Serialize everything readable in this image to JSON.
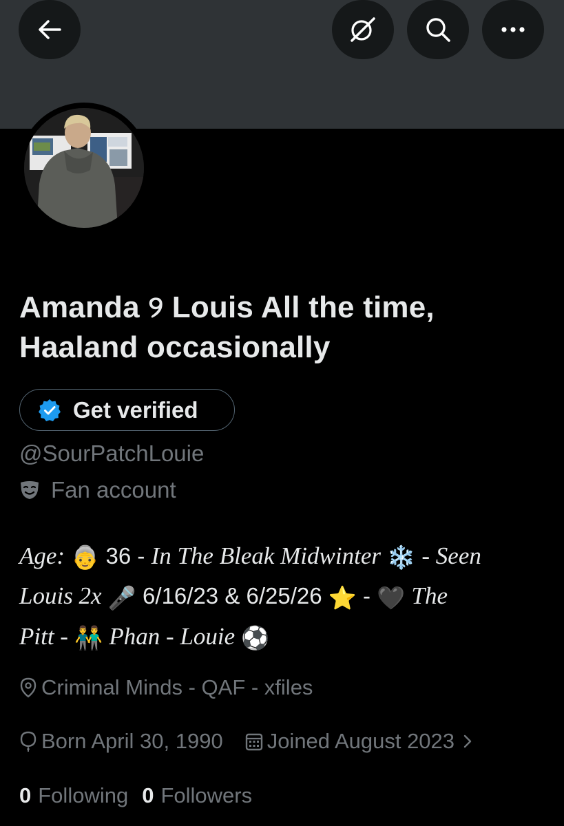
{
  "header": {
    "back_icon": "arrow-left-icon",
    "grok_icon": "grok-icon",
    "search_icon": "search-icon",
    "more_icon": "more-horizontal-icon"
  },
  "profile": {
    "avatar_alt": "profile photo",
    "display_name": "Amanda ୨ Louis All the time, Haaland occasionally",
    "verify_button_label": "Get verified",
    "handle": "@SourPatchLouie",
    "category_icon": "theater-mask-icon",
    "category": "Fan account",
    "bio": {
      "age_label": "Age:",
      "age_emoji": "👵",
      "age_value": "36 -",
      "midwinter": "In The Bleak Midwinter",
      "snow_emoji": "❄️",
      "seen": "- Seen",
      "louis": "Louis 2x",
      "mic_emoji": "🎤",
      "dates": "6/16/23 & 6/25/26",
      "star_emoji": "⭐",
      "dash1": "-",
      "heart_emoji": "🖤",
      "the": "The",
      "pitt": "Pitt -",
      "men_emoji": "👬",
      "phan": "Phan - Louie",
      "ball_emoji": "⚽"
    },
    "location": "Criminal Minds - QAF - xfiles",
    "birthday": "Born April 30, 1990",
    "joined": "Joined August 2023",
    "following_count": "0",
    "following_label": "Following",
    "followers_count": "0",
    "followers_label": "Followers"
  },
  "colors": {
    "background": "#000000",
    "banner": "#2f3336",
    "text_primary": "#e7e9ea",
    "text_secondary": "#71767b",
    "verified_blue": "#1d9bf0"
  }
}
